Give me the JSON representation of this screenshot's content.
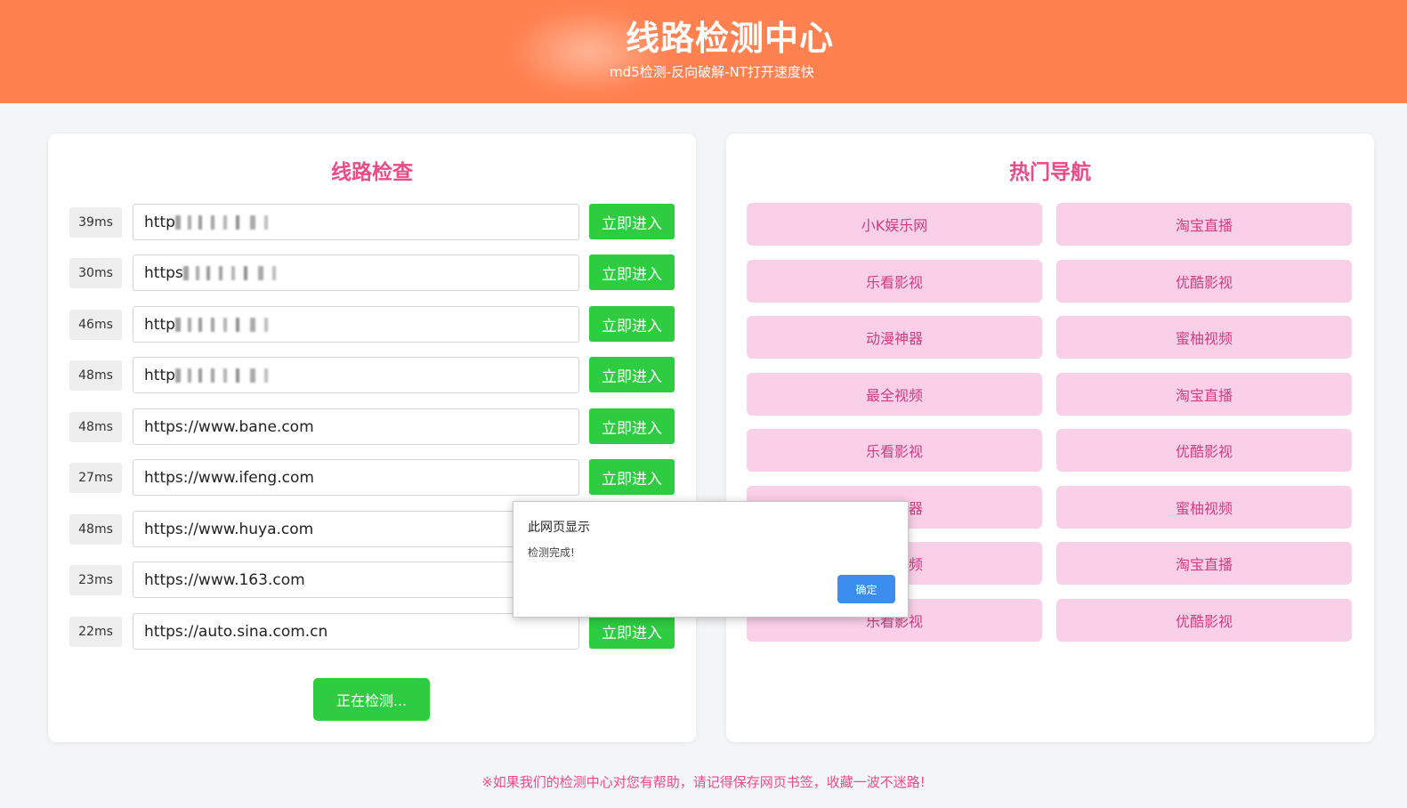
{
  "header": {
    "title": "线路检测中心",
    "subtitle": "md5检测-反向破解-NT打开速度快"
  },
  "check_panel": {
    "title": "线路检查",
    "enter_label": "立即进入",
    "detect_button": "正在检测...",
    "rows": [
      {
        "latency": "39ms",
        "url": "http"
      },
      {
        "latency": "30ms",
        "url": "https"
      },
      {
        "latency": "46ms",
        "url": "http"
      },
      {
        "latency": "48ms",
        "url": "http"
      },
      {
        "latency": "48ms",
        "url": "https://www.bane.com"
      },
      {
        "latency": "27ms",
        "url": "https://www.ifeng.com"
      },
      {
        "latency": "48ms",
        "url": "https://www.huya.com"
      },
      {
        "latency": "23ms",
        "url": "https://www.163.com"
      },
      {
        "latency": "22ms",
        "url": "https://auto.sina.com.cn"
      }
    ]
  },
  "nav_panel": {
    "title": "热门导航",
    "links": [
      "小K娱乐网",
      "淘宝直播",
      "乐看影视",
      "优酷影视",
      "动漫神器",
      "蜜柚视频",
      "最全视频",
      "淘宝直播",
      "乐看影视",
      "优酷影视",
      "动漫神器",
      "蜜柚视频",
      "最全视频",
      "淘宝直播",
      "乐看影视",
      "优酷影视"
    ]
  },
  "dialog": {
    "title": "此网页显示",
    "message": "检测完成!",
    "ok_label": "确定"
  },
  "footer": {
    "text": "※如果我们的检测中心对您有帮助，请记得保存网页书签，收藏一波不迷路!"
  },
  "colors": {
    "header_bg": "#ff8150",
    "accent_pink": "#ea4c89",
    "green_button": "#2ecc40",
    "nav_button_bg": "#fad0e9",
    "dialog_ok": "#3b8ef0"
  }
}
